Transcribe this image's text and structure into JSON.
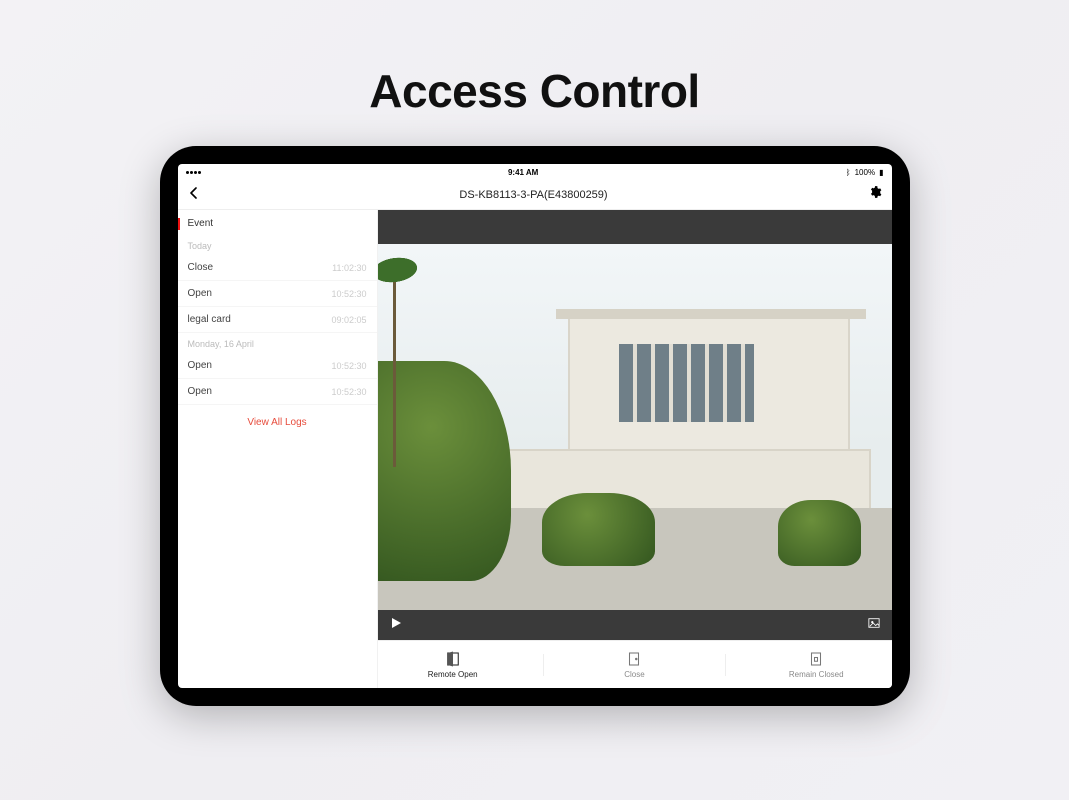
{
  "page": {
    "title": "Access Control"
  },
  "statusbar": {
    "time": "9:41 AM",
    "battery": "100%"
  },
  "navbar": {
    "device_title": "DS-KB8113-3-PA(E43800259)"
  },
  "sidebar": {
    "section_label": "Event",
    "groups": [
      {
        "date_label": "Today",
        "rows": [
          {
            "name": "Close",
            "time": "11:02:30"
          },
          {
            "name": "Open",
            "time": "10:52:30"
          },
          {
            "name": "legal card",
            "time": "09:02:05"
          }
        ]
      },
      {
        "date_label": "Monday, 16 April",
        "rows": [
          {
            "name": "Open",
            "time": "10:52:30"
          },
          {
            "name": "Open",
            "time": "10:52:30"
          }
        ]
      }
    ],
    "view_all_label": "View All Logs"
  },
  "actions": {
    "remote_open": "Remote Open",
    "close": "Close",
    "remain_closed": "Remain Closed"
  }
}
